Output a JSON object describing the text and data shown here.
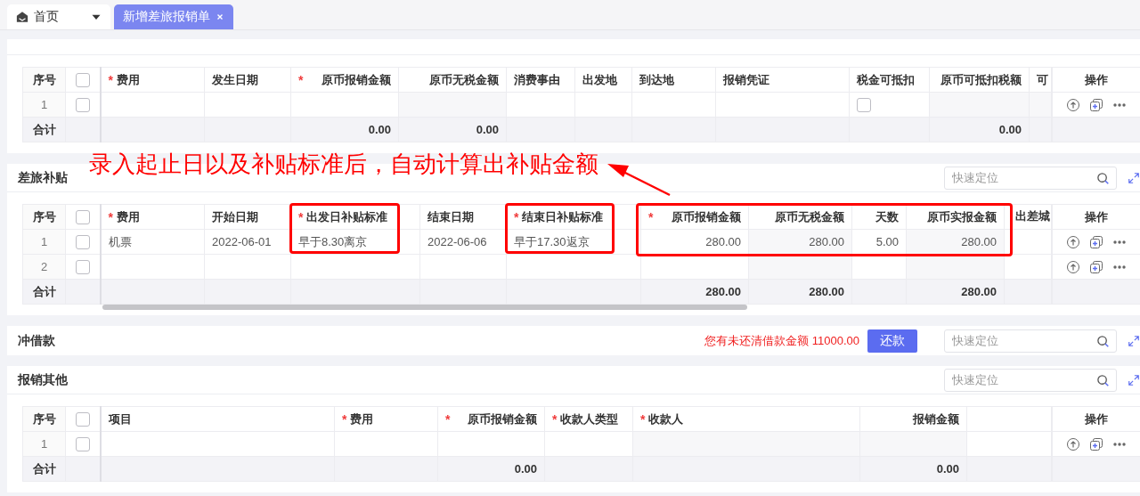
{
  "tabs": [
    {
      "label": "首页",
      "selected": false
    },
    {
      "label": "新增差旅报销单",
      "selected": true
    }
  ],
  "sections": [
    {
      "kind": "table",
      "table": {
        "columns": [
          {
            "label": "序号",
            "kind": "index"
          },
          {
            "kind": "checkbox",
            "checked": false
          },
          {
            "label": "费用",
            "required_mark": "*"
          },
          {
            "label": "发生日期"
          },
          {
            "label": "原币报销金额",
            "required_mark": "*",
            "kind": "amount"
          },
          {
            "label": "原币无税金额",
            "kind": "amount",
            "readonly": true
          },
          {
            "label": "消费事由"
          },
          {
            "label": "出发地"
          },
          {
            "label": "到达地"
          },
          {
            "label": "报销凭证"
          },
          {
            "label": "税金可抵扣"
          },
          {
            "label": "原币可抵扣税额",
            "kind": "amount",
            "readonly": true
          },
          {
            "label": "可",
            "readonly": true
          },
          {
            "label": "操作",
            "kind": "actions"
          }
        ],
        "rows": [
          {
            "cells": [
              "1",
              {
                "checked": false
              },
              null,
              null,
              null,
              null,
              null,
              null,
              null,
              null,
              {
                "checked": false
              },
              null,
              null,
              null
            ]
          }
        ],
        "total": {
          "cells": [
            "合计",
            null,
            null,
            null,
            "0.00",
            "0.00",
            null,
            null,
            null,
            null,
            null,
            "0.00",
            null,
            null
          ]
        }
      }
    },
    {
      "kind": "table",
      "title": "差旅补贴",
      "search": {
        "placeholder": "快速定位"
      },
      "table": {
        "columns": [
          {
            "label": "序号",
            "kind": "index"
          },
          {
            "kind": "checkbox",
            "checked": false
          },
          {
            "label": "费用",
            "required_mark": "*"
          },
          {
            "label": "开始日期"
          },
          {
            "label": "出发日补贴标准",
            "required_mark": "*"
          },
          {
            "label": "结束日期"
          },
          {
            "label": "结束日补贴标准",
            "required_mark": "*"
          },
          {
            "label": "原币报销金额",
            "required_mark": "*",
            "kind": "amount"
          },
          {
            "label": "原币无税金额",
            "kind": "amount",
            "readonly": true
          },
          {
            "label": "天数",
            "kind": "amount"
          },
          {
            "label": "原币实报金额",
            "kind": "amount",
            "readonly": true
          },
          {
            "label": "出差城",
            "kind": "cut"
          },
          {
            "label": "操作",
            "kind": "actions"
          }
        ],
        "rows": [
          {
            "cells": [
              "1",
              {
                "checked": false
              },
              "机票",
              "2022-06-01",
              "早于8.30离京",
              "2022-06-06",
              "早于17.30返京",
              "280.00",
              "280.00",
              "5.00",
              "280.00",
              null,
              null
            ]
          },
          {
            "cells": [
              "2",
              {
                "checked": false
              },
              null,
              null,
              null,
              null,
              null,
              null,
              null,
              null,
              null,
              null,
              null
            ]
          }
        ],
        "total": {
          "cells": [
            "合计",
            null,
            null,
            null,
            null,
            null,
            null,
            "280.00",
            "280.00",
            null,
            "280.00",
            null,
            null
          ]
        }
      }
    },
    {
      "kind": "loan",
      "title": "冲借款",
      "notice": "您有未还清借款金额 11000.00",
      "button": "还款",
      "search": {
        "placeholder": "快速定位"
      }
    },
    {
      "kind": "table",
      "title": "报销其他",
      "search": {
        "placeholder": "快速定位"
      },
      "table": {
        "columns": [
          {
            "label": "序号",
            "kind": "index"
          },
          {
            "kind": "checkbox",
            "checked": false
          },
          {
            "label": "项目"
          },
          {
            "label": "费用",
            "required_mark": "*"
          },
          {
            "label": "原币报销金额",
            "required_mark": "*",
            "kind": "amount"
          },
          {
            "label": "收款人类型",
            "required_mark": "*"
          },
          {
            "label": "收款人",
            "required_mark": "*",
            "readonly": true
          },
          {
            "label": "报销金额",
            "kind": "amount",
            "readonly": true
          },
          {
            "kind": "blank"
          },
          {
            "label": "操作",
            "kind": "actions"
          }
        ],
        "rows": [
          {
            "cells": [
              "1",
              {
                "checked": false
              },
              null,
              null,
              null,
              null,
              null,
              null,
              null,
              null
            ]
          }
        ],
        "total": {
          "cells": [
            "合计",
            null,
            null,
            null,
            "0.00",
            null,
            null,
            "0.00",
            null,
            null
          ]
        }
      }
    }
  ],
  "annotation": {
    "text": "录入起止日以及补贴标准后，自动计算出补贴金额"
  }
}
